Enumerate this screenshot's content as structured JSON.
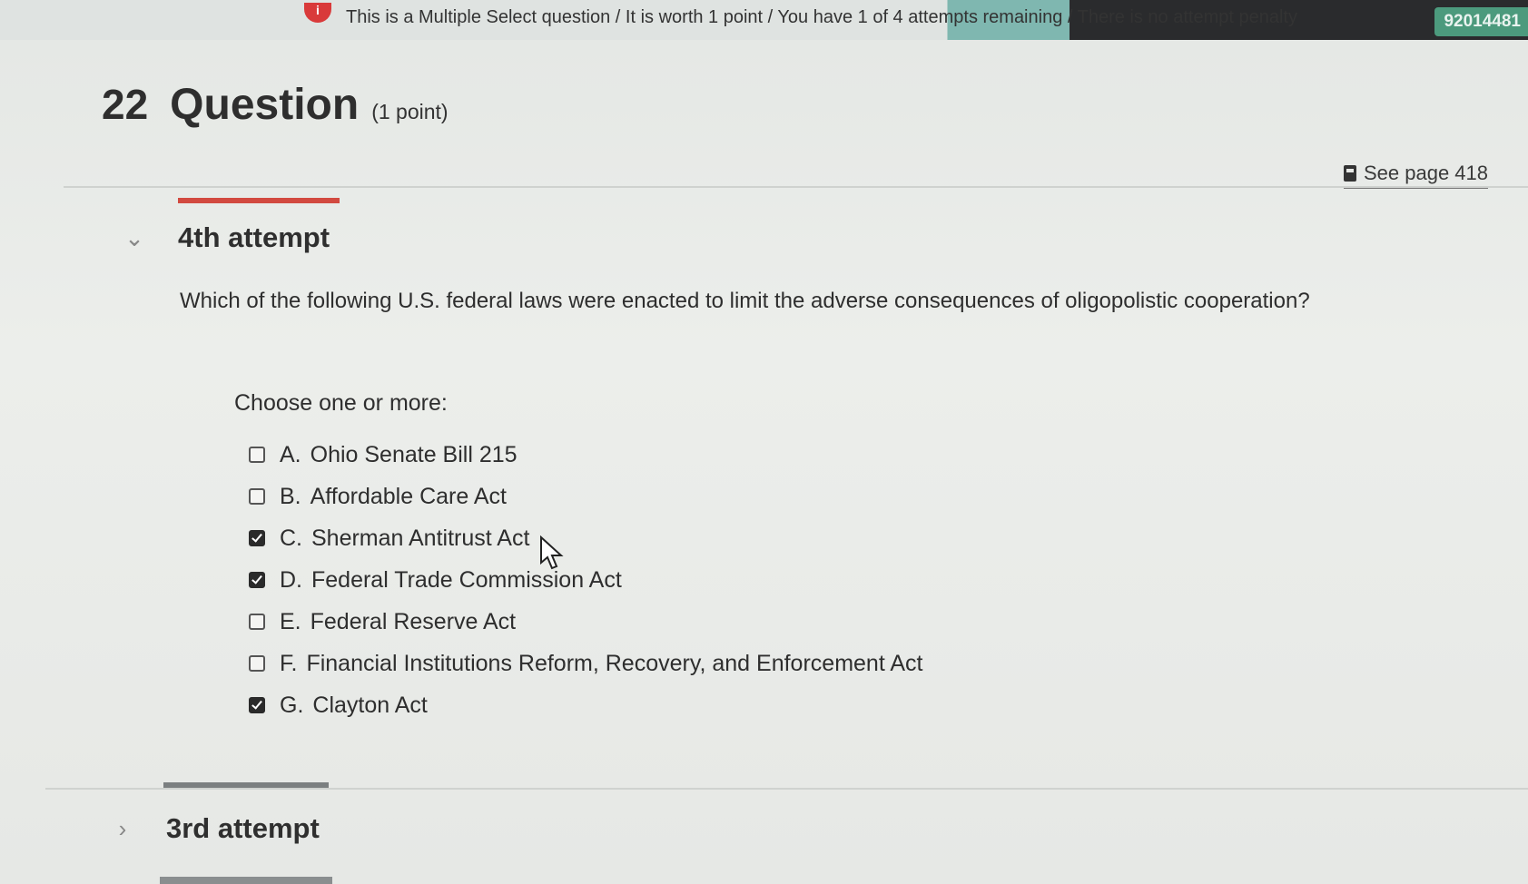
{
  "header": {
    "notice": "This is a Multiple Select question / It is worth 1 point / You have 1 of 4 attempts remaining / There is no attempt penalty",
    "user_id": "92014481"
  },
  "question": {
    "number": "22",
    "title": "Question",
    "points": "(1 point)",
    "see_page": "See page 418",
    "text": "Which of the following U.S. federal laws were enacted to limit the adverse consequences of oligopolistic cooperation?",
    "prompt": "Choose one or more:"
  },
  "attempts": {
    "current": "4th attempt",
    "previous": "3rd attempt"
  },
  "options": [
    {
      "letter": "A.",
      "label": "Ohio Senate Bill 215",
      "checked": false
    },
    {
      "letter": "B.",
      "label": "Affordable Care Act",
      "checked": false
    },
    {
      "letter": "C.",
      "label": "Sherman Antitrust Act",
      "checked": true
    },
    {
      "letter": "D.",
      "label": "Federal Trade Commission Act",
      "checked": true
    },
    {
      "letter": "E.",
      "label": "Federal Reserve Act",
      "checked": false
    },
    {
      "letter": "F.",
      "label": "Financial Institutions Reform, Recovery, and Enforcement Act",
      "checked": false
    },
    {
      "letter": "G.",
      "label": "Clayton Act",
      "checked": true
    }
  ],
  "colors": {
    "active_attempt_bar": "#d24a40",
    "user_badge": "#4c9a7d",
    "info_icon": "#d93a3a"
  }
}
